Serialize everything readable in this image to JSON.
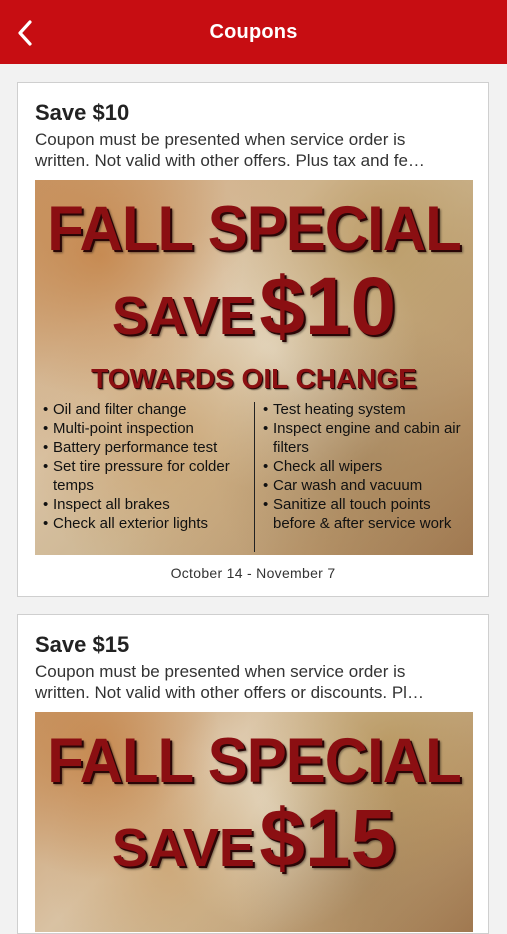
{
  "header": {
    "title": "Coupons",
    "back_icon": "chevron-left-icon",
    "color": "#c70d12"
  },
  "coupons": [
    {
      "title": "Save $10",
      "description_lines": [
        "Coupon must be presented when service order is",
        "written. Not valid with other offers. Plus tax and fe…"
      ],
      "banner": {
        "headline": "FALL SPECIAL",
        "save_word": "SAVE",
        "amount": "$10",
        "subheadline": "TOWARDS OIL CHANGE",
        "left_items": [
          "Oil and filter change",
          "Multi-point inspection",
          "Battery performance test",
          "Set tire pressure for colder temps",
          "Inspect all brakes",
          "Check all exterior lights"
        ],
        "right_items": [
          "Test heating system",
          "Inspect engine and cabin air filters",
          "Check all wipers",
          "Car wash and vacuum",
          "Sanitize all touch points before & after service work"
        ]
      },
      "dates": "October 14 - November 7"
    },
    {
      "title": "Save $15",
      "description_lines": [
        "Coupon must be presented when service order is",
        "written. Not valid with other offers or discounts. Pl…"
      ],
      "banner": {
        "headline": "FALL SPECIAL",
        "save_word": "SAVE",
        "amount": "$15"
      }
    }
  ]
}
